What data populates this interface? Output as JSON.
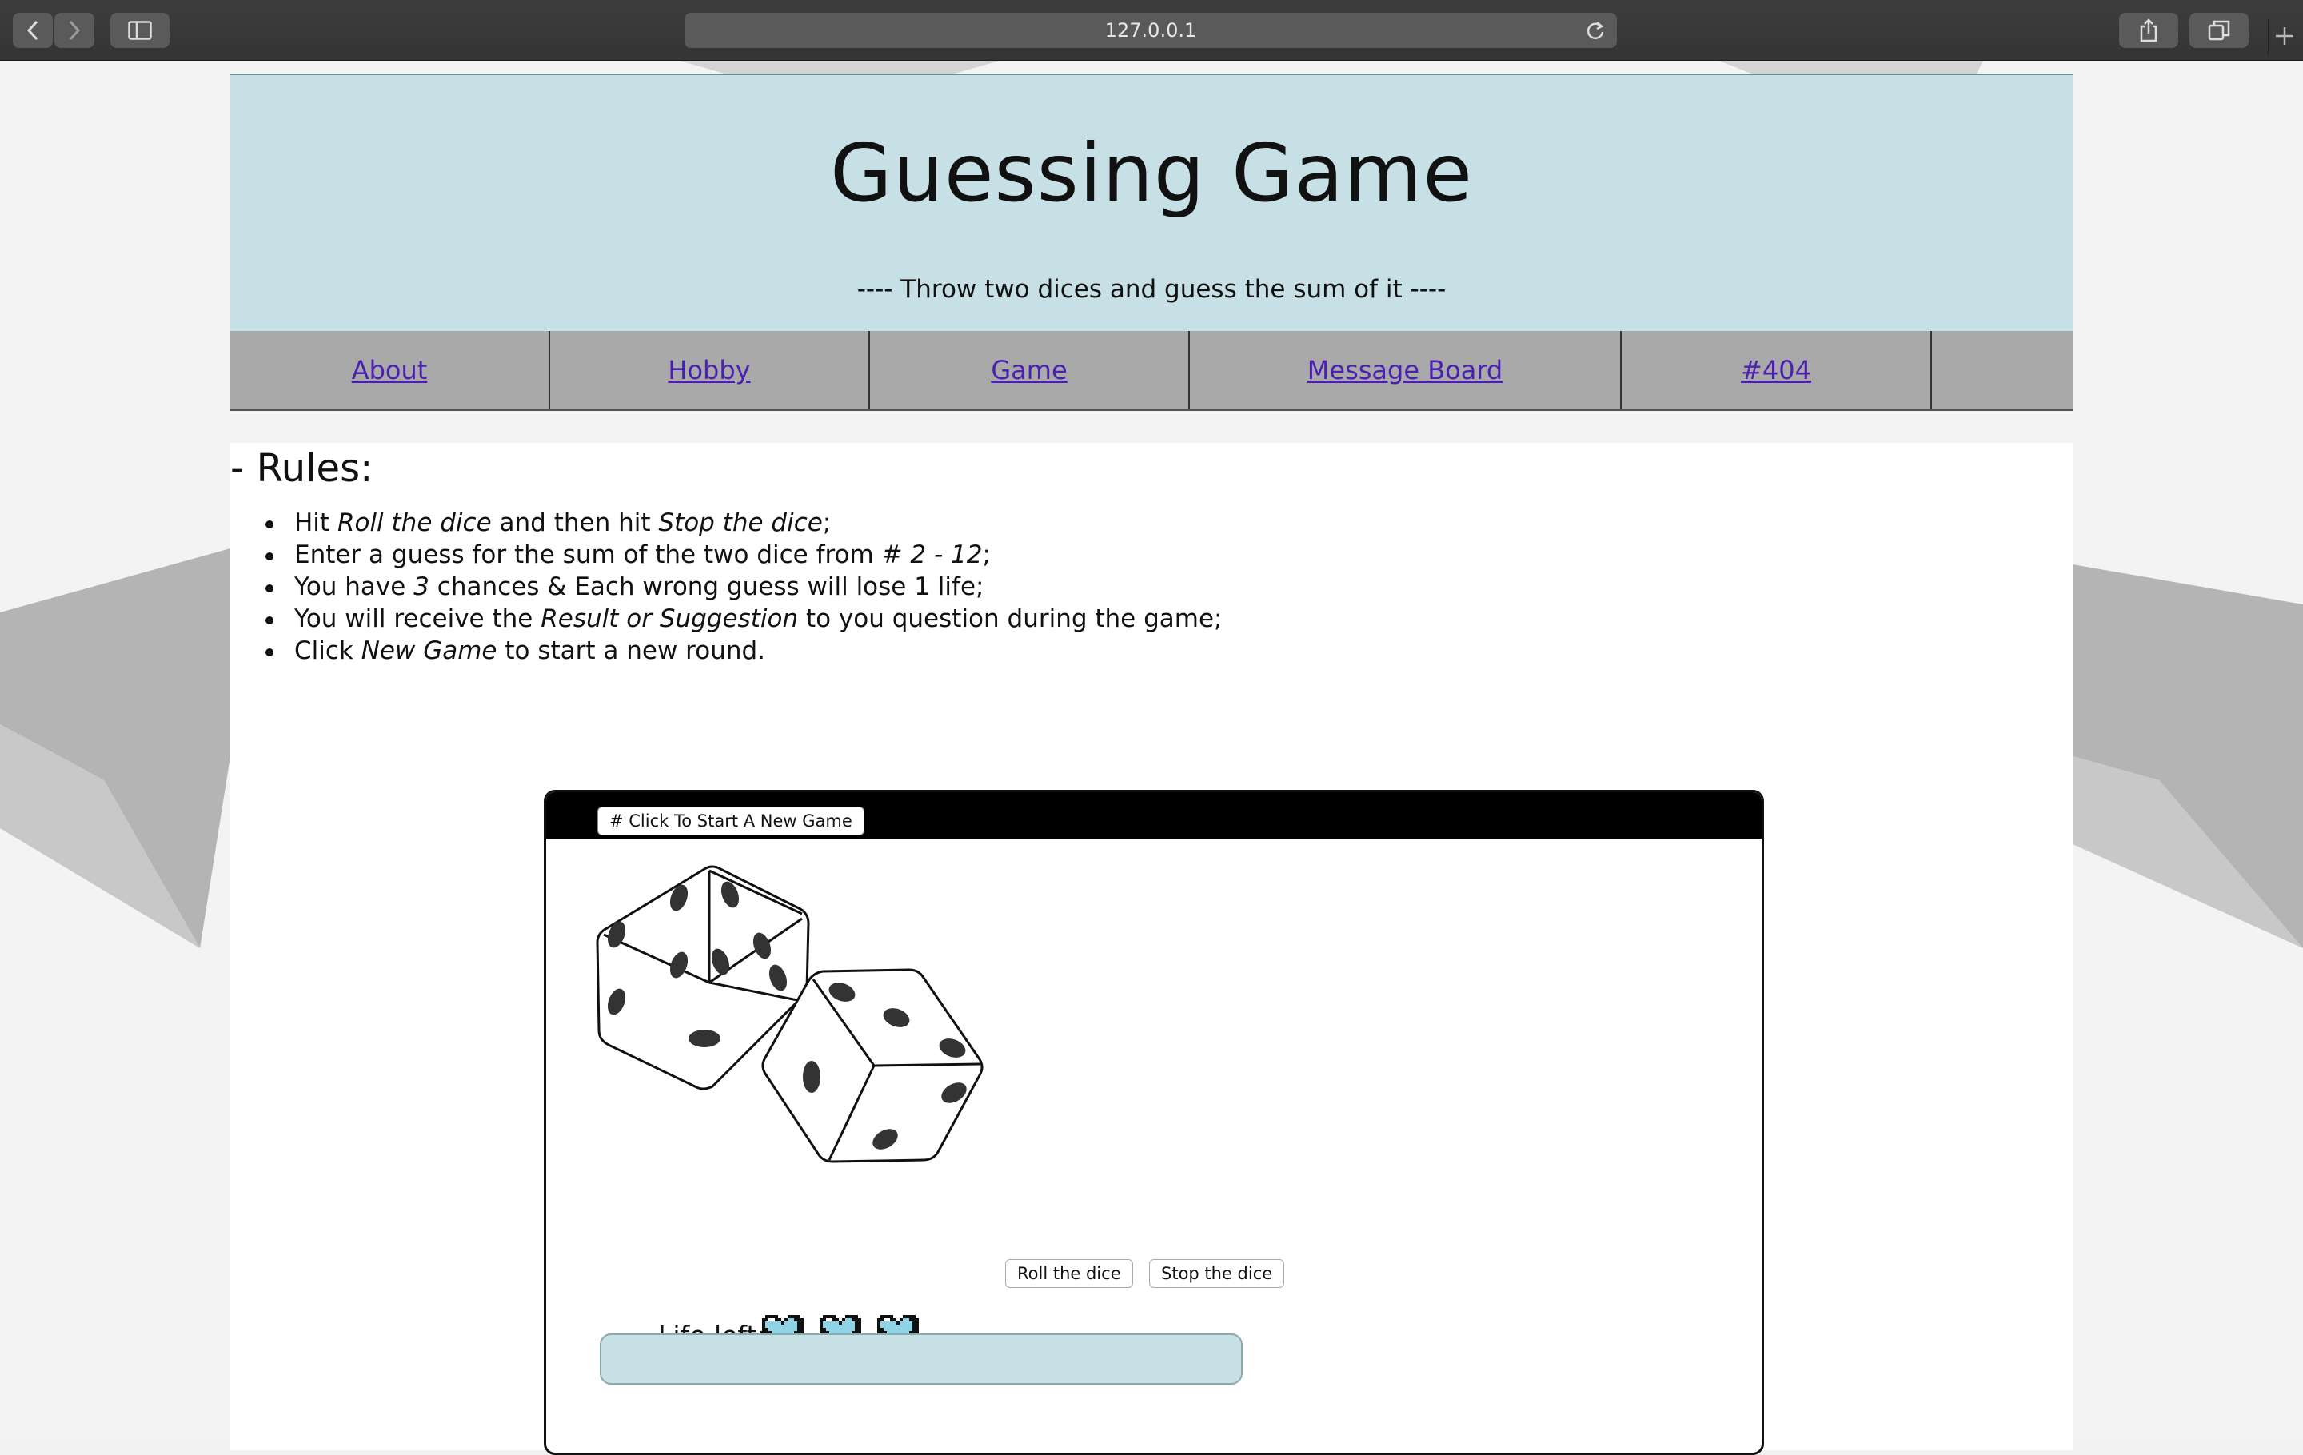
{
  "browser": {
    "url": "127.0.0.1"
  },
  "header": {
    "title": "Guessing Game",
    "subtitle": "---- Throw two dices and guess the sum of it ----"
  },
  "nav": {
    "items": [
      {
        "label": "About"
      },
      {
        "label": "Hobby"
      },
      {
        "label": "Game"
      },
      {
        "label": "Message Board"
      },
      {
        "label": "#404"
      }
    ]
  },
  "rules": {
    "heading": "- Rules:",
    "items": [
      {
        "pre": "Hit ",
        "em1": "Roll the dice",
        "mid": " and then hit ",
        "em2": "Stop the dice",
        "post": ";"
      },
      {
        "pre": "Enter a guess for the sum of the two dice from ",
        "em1": "# 2 - 12",
        "mid": ";",
        "em2": "",
        "post": ""
      },
      {
        "pre": "You have ",
        "em1": "3",
        "mid": " chances & Each wrong guess will lose 1 life;",
        "em2": "",
        "post": ""
      },
      {
        "pre": "You will receive the ",
        "em1": "Result or Suggestion",
        "mid": " to you question during the game;",
        "em2": "",
        "post": ""
      },
      {
        "pre": "Click ",
        "em1": "New Game",
        "mid": " to start a new round.",
        "em2": "",
        "post": ""
      }
    ]
  },
  "game": {
    "new_game_label": "# Click To Start A New Game",
    "roll_label": "Roll the dice",
    "stop_label": "Stop the dice",
    "life_label": "Life left:",
    "lives": 3,
    "heart_color": "#8fd3e6"
  },
  "colors": {
    "header_bg": "#c7e0e5",
    "nav_bg": "#a9a9a9",
    "link": "#4b1fb0"
  }
}
